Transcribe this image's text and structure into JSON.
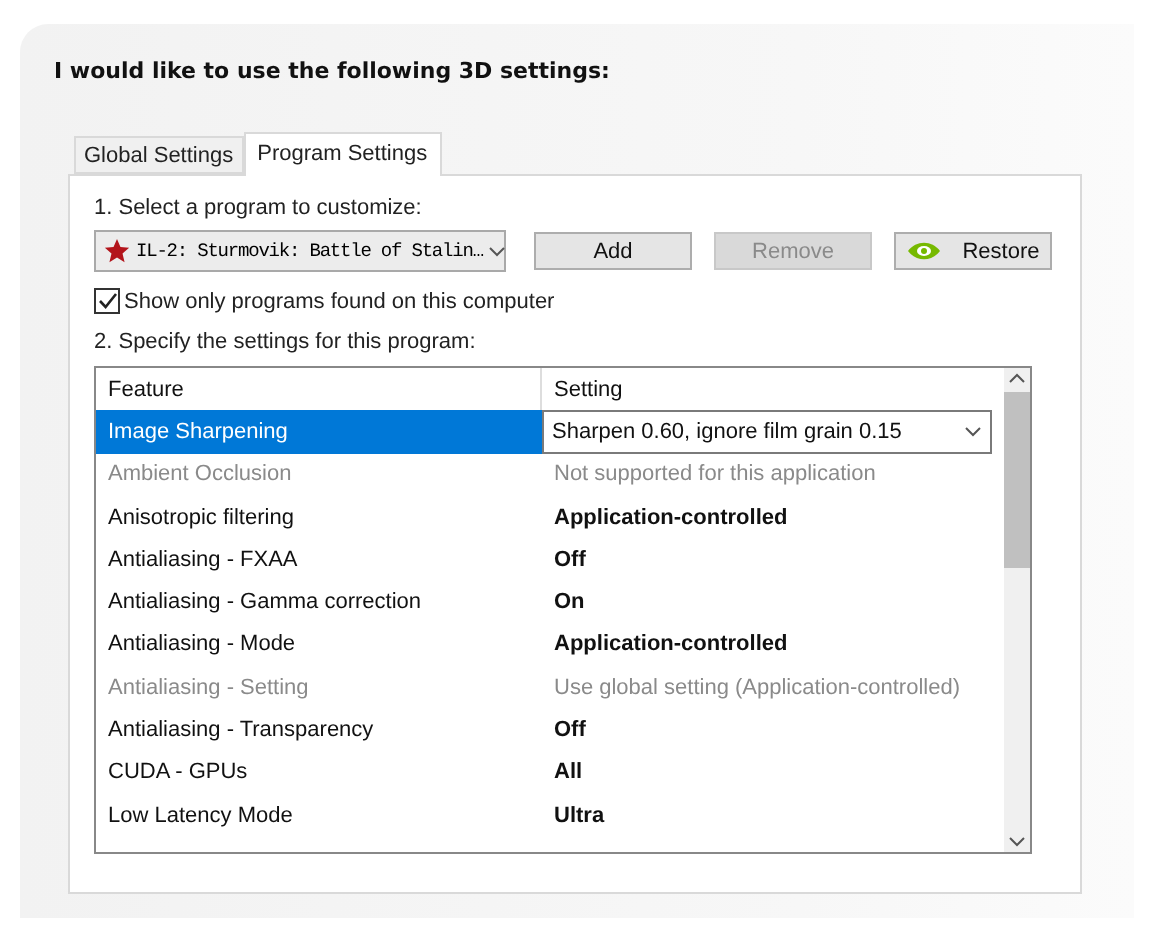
{
  "heading": "I would like to use the following 3D settings:",
  "tabs": [
    {
      "label": "Global Settings",
      "selected": false
    },
    {
      "label": "Program Settings",
      "selected": true
    }
  ],
  "program_label": "1. Select a program to customize:",
  "program": {
    "value": "IL-2: Sturmovik: Battle of Stalin…"
  },
  "buttons": [
    {
      "label": "Add",
      "disabled": false,
      "kind": "plain"
    },
    {
      "label": "Remove",
      "disabled": true,
      "kind": "plain"
    },
    {
      "label": "Restore",
      "disabled": false,
      "kind": "logo"
    }
  ],
  "show_only": {
    "label": "Show only programs found on this computer",
    "checked": true
  },
  "settings_label": "2. Specify the settings for this program:",
  "table": {
    "columns": [
      "Feature",
      "Setting"
    ],
    "rows": [
      {
        "feature": "Image Sharpening",
        "setting": "Sharpen 0.60, ignore film grain 0.15",
        "selected": true,
        "kind": "dropdown"
      },
      {
        "feature": "Ambient Occlusion",
        "setting": "Not supported for this application",
        "selected": false,
        "kind": "unavailable"
      },
      {
        "feature": "Anisotropic filtering",
        "setting": "Application-controlled",
        "selected": false,
        "kind": "changed"
      },
      {
        "feature": "Antialiasing - FXAA",
        "setting": "Off",
        "selected": false,
        "kind": "changed"
      },
      {
        "feature": "Antialiasing - Gamma correction",
        "setting": "On",
        "selected": false,
        "kind": "changed"
      },
      {
        "feature": "Antialiasing - Mode",
        "setting": "Application-controlled",
        "selected": false,
        "kind": "changed"
      },
      {
        "feature": "Antialiasing - Setting",
        "setting": "Use global setting (Application-controlled)",
        "selected": false,
        "kind": "unavailable"
      },
      {
        "feature": "Antialiasing - Transparency",
        "setting": "Off",
        "selected": false,
        "kind": "changed"
      },
      {
        "feature": "CUDA - GPUs",
        "setting": "All",
        "selected": false,
        "kind": "changed"
      },
      {
        "feature": "Low Latency Mode",
        "setting": "Ultra",
        "selected": false,
        "kind": "changed"
      }
    ]
  }
}
